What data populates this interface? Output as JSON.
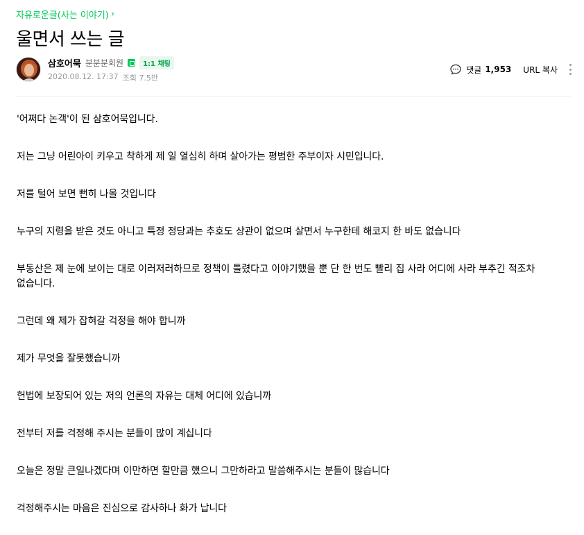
{
  "board": {
    "name": "자유로운글(사는 이야기)",
    "chevron": "›"
  },
  "post": {
    "title": "울면서 쓰는 글",
    "author": {
      "nickname": "삼호어묵",
      "level": "분분분회원",
      "level_icon": "member-level-icon",
      "chat_label": "1:1 채팅"
    },
    "date": "2020.08.12. 17:37",
    "views": "조회 7.5만",
    "comments_label": "댓글",
    "comments_count": "1,953",
    "url_copy": "URL 복사",
    "paragraphs": [
      "'어쩌다 논객'이 된 삼호어묵입니다.",
      "저는 그냥 어린아이 키우고 착하게 제 일 열심히 하며 살아가는 평범한 주부이자 시민입니다.",
      "저를 털어 보면 뻔히 나올 것입니다",
      "누구의 지령을 받은 것도 아니고 특정 정당과는 추호도 상관이 없으며 살면서 누구한테 해코지 한 바도 없습니다",
      "부동산은 제 눈에 보이는 대로 이러저러하므로 정책이 틀렸다고 이야기했을 뿐 단 한 번도 빨리 집 사라 어디에 사라 부추긴 적조차 없습니다.",
      "그런데 왜 제가 잡혀갈 걱정을 해야 합니까",
      "제가 무엇을 잘못했습니까",
      "헌법에 보장되어 있는 저의 언론의 자유는 대체 어디에 있습니까",
      "전부터 저를 걱정해 주시는 분들이 많이 계십니다",
      "오늘은 정말 큰일나겠다며 이만하면 할만큼 했으니 그만하라고 말씀해주시는 분들이 많습니다",
      "걱정해주시는 마음은 진심으로 감사하나 화가 납니다"
    ]
  },
  "colors": {
    "accent": "#03c75a",
    "meta": "#979797",
    "divider": "#ebebeb"
  }
}
